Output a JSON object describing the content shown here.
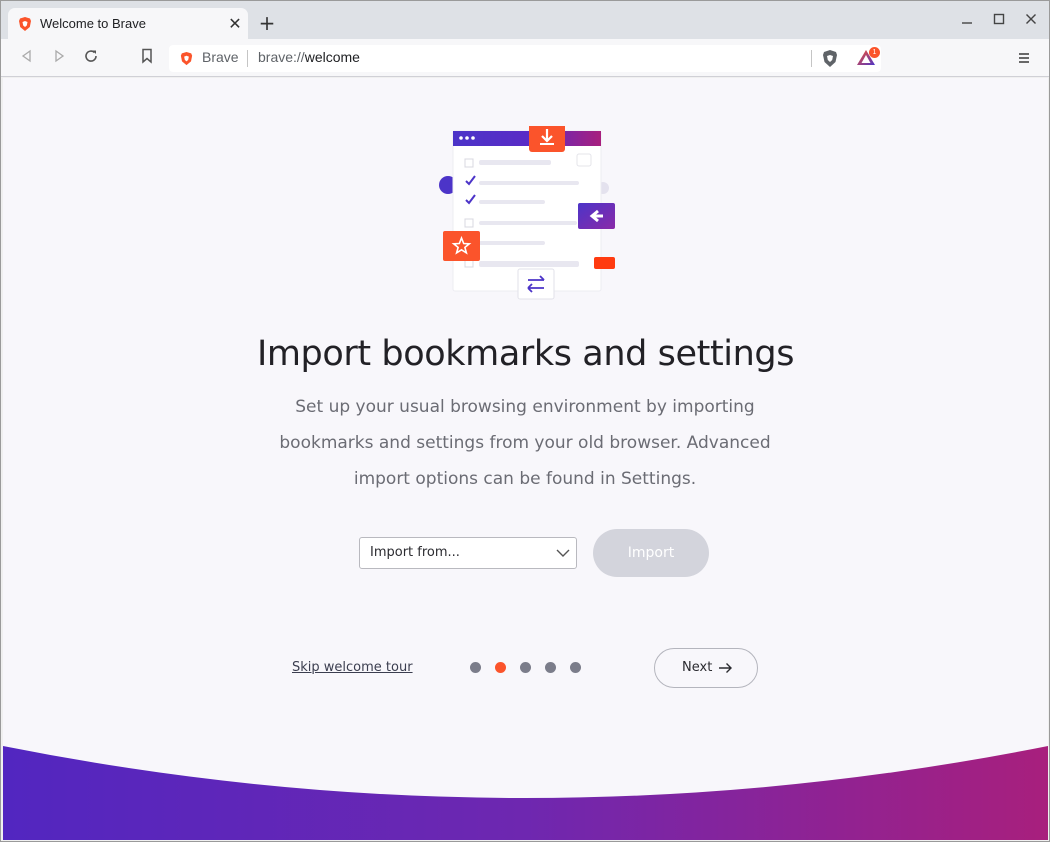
{
  "tab": {
    "title": "Welcome to Brave",
    "favicon": "brave-lion-icon"
  },
  "window_controls": {
    "minimize": "—",
    "maximize": "☐",
    "close": "✕"
  },
  "toolbar": {
    "omnibox_label": "Brave",
    "url_scheme": "brave://",
    "url_host": "welcome",
    "rewards_badge": "1"
  },
  "page": {
    "heading": "Import bookmarks and settings",
    "description": "Set up your usual browsing environment by importing bookmarks and settings from your old browser. Advanced import options can be found in Settings.",
    "import_select": {
      "value": "Import from..."
    },
    "import_button": "Import",
    "skip_link": "Skip welcome tour",
    "pager": {
      "total": 5,
      "active_index": 1
    },
    "next_button": "Next"
  },
  "colors": {
    "accent": "#fb542b",
    "brand_purple": "#4c34c8",
    "brand_magenta": "#a81f7d",
    "disabled_button": "#d3d4dc"
  }
}
